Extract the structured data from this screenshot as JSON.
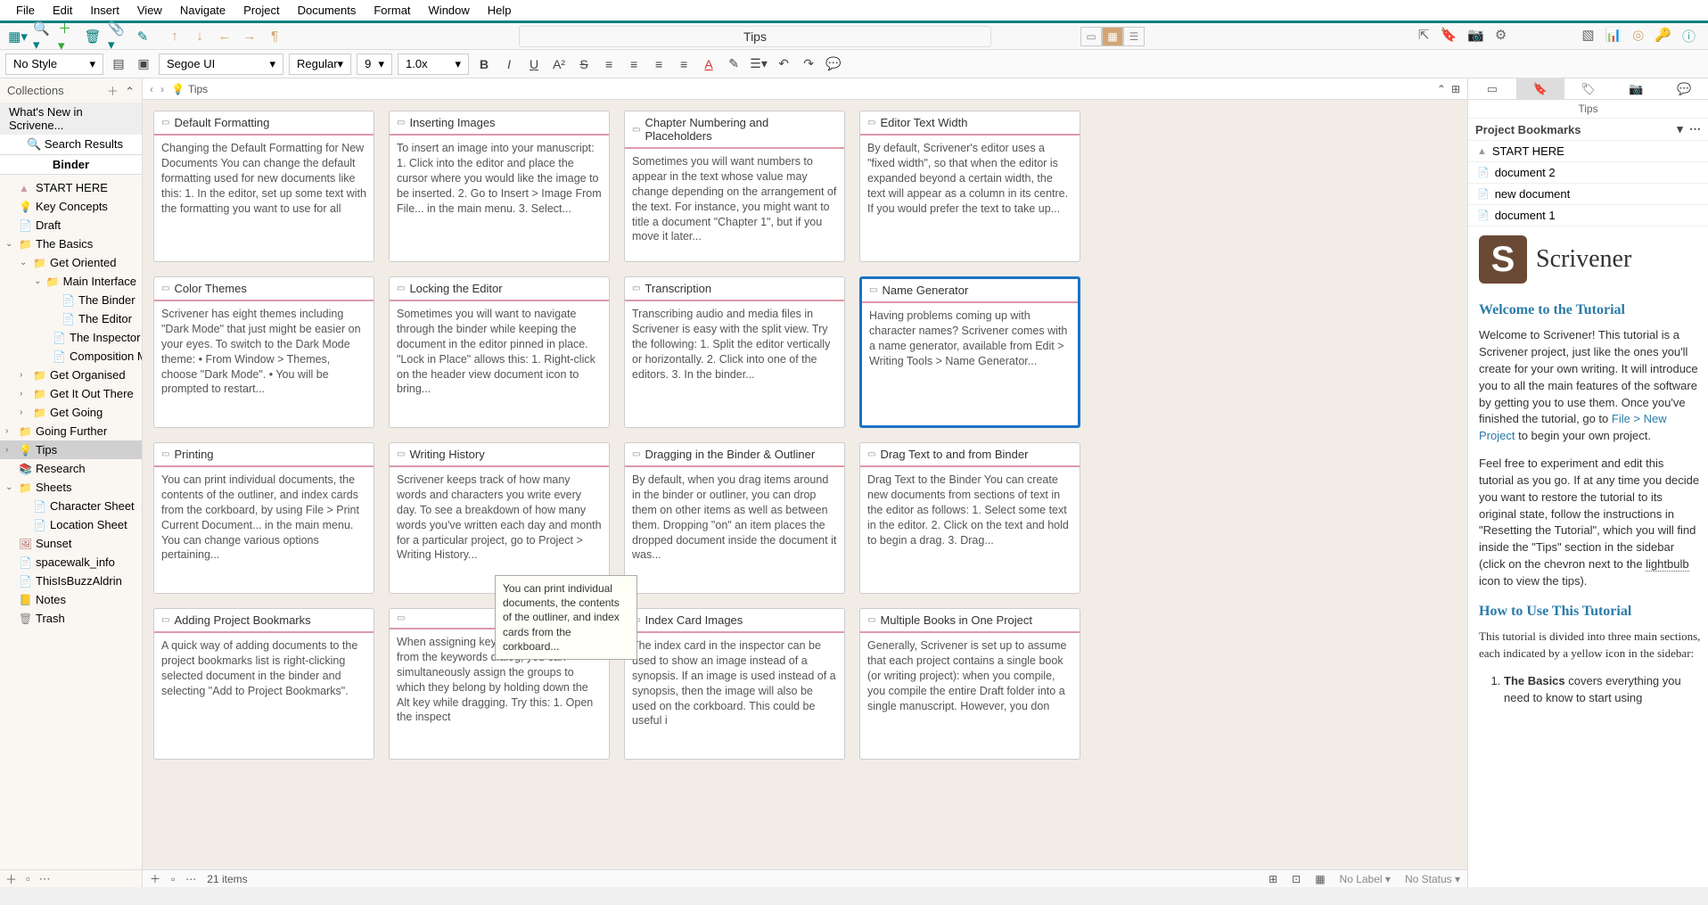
{
  "menu": [
    "File",
    "Edit",
    "Insert",
    "View",
    "Navigate",
    "Project",
    "Documents",
    "Format",
    "Window",
    "Help"
  ],
  "toolbar": {
    "centerTitle": "Tips"
  },
  "fmt": {
    "style": "No Style",
    "font": "Segoe UI",
    "weight": "Regular",
    "size": "9",
    "spacing": "1.0x"
  },
  "collections": {
    "header": "Collections",
    "whatsnew": "What's New in Scrivene...",
    "searchResults": "Search Results",
    "binder": "Binder"
  },
  "tree": [
    {
      "icon": "▲",
      "label": "START HERE",
      "indent": 0,
      "color": "#c9a",
      "tw": ""
    },
    {
      "icon": "💡",
      "label": "Key Concepts",
      "indent": 0,
      "color": "#c9a",
      "tw": ""
    },
    {
      "icon": "📄",
      "label": "Draft",
      "indent": 0,
      "color": "#888",
      "tw": ""
    },
    {
      "icon": "📁",
      "label": "The Basics",
      "indent": 0,
      "color": "#d9b04a",
      "tw": "⌄"
    },
    {
      "icon": "📁",
      "label": "Get Oriented",
      "indent": 1,
      "color": "#d9b04a",
      "tw": "⌄"
    },
    {
      "icon": "📁",
      "label": "Main Interface",
      "indent": 2,
      "color": "#d9b04a",
      "tw": "⌄"
    },
    {
      "icon": "📄",
      "label": "The Binder",
      "indent": 3,
      "color": "#888",
      "tw": ""
    },
    {
      "icon": "📄",
      "label": "The Editor",
      "indent": 3,
      "color": "#888",
      "tw": ""
    },
    {
      "icon": "📄",
      "label": "The Inspector",
      "indent": 3,
      "color": "#888",
      "tw": ""
    },
    {
      "icon": "📄",
      "label": "Composition Mode",
      "indent": 3,
      "color": "#888",
      "tw": ""
    },
    {
      "icon": "📁",
      "label": "Get Organised",
      "indent": 1,
      "color": "#d9b04a",
      "tw": "›"
    },
    {
      "icon": "📁",
      "label": "Get It Out There",
      "indent": 1,
      "color": "#d9b04a",
      "tw": "›"
    },
    {
      "icon": "📁",
      "label": "Get Going",
      "indent": 1,
      "color": "#d9b04a",
      "tw": "›"
    },
    {
      "icon": "📁",
      "label": "Going Further",
      "indent": 0,
      "color": "#d9b04a",
      "tw": "›"
    },
    {
      "icon": "💡",
      "label": "Tips",
      "indent": 0,
      "color": "#c9a",
      "tw": "›",
      "sel": true
    },
    {
      "icon": "📚",
      "label": "Research",
      "indent": 0,
      "color": "#888",
      "tw": ""
    },
    {
      "icon": "📁",
      "label": "Sheets",
      "indent": 0,
      "color": "#d9b04a",
      "tw": "⌄"
    },
    {
      "icon": "📄",
      "label": "Character Sheet",
      "indent": 1,
      "color": "#888",
      "tw": ""
    },
    {
      "icon": "📄",
      "label": "Location Sheet",
      "indent": 1,
      "color": "#888",
      "tw": ""
    },
    {
      "icon": "🖼",
      "label": "Sunset",
      "indent": 0,
      "color": "#a66",
      "tw": ""
    },
    {
      "icon": "📄",
      "label": "spacewalk_info",
      "indent": 0,
      "color": "#888",
      "tw": ""
    },
    {
      "icon": "📄",
      "label": "ThisIsBuzzAldrin",
      "indent": 0,
      "color": "#888",
      "tw": ""
    },
    {
      "icon": "📒",
      "label": "Notes",
      "indent": 0,
      "color": "#888",
      "tw": ""
    },
    {
      "icon": "🗑",
      "label": "Trash",
      "indent": 0,
      "color": "#888",
      "tw": ""
    }
  ],
  "breadcrumb": "Tips",
  "cards": [
    {
      "t": "Default Formatting",
      "b": "Changing the Default Formatting for New Documents You can change the default formatting used for new documents like this: 1. In the editor, set up some text with the formatting you want to use for all"
    },
    {
      "t": "Inserting Images",
      "b": "To insert an image into your manuscript: 1. Click into the editor and place the cursor where you would like the image to be inserted. 2. Go to Insert > Image From File... in the main menu. 3. Select..."
    },
    {
      "t": "Chapter Numbering and Placeholders",
      "b": "Sometimes you will want numbers to appear in the text whose value may change depending on the arrangement of the text. For instance, you might want to title a document \"Chapter 1\", but if you move it later..."
    },
    {
      "t": "Editor Text Width",
      "b": "By default, Scrivener's editor uses a \"fixed width\", so that when the editor is expanded beyond a certain width, the text will appear as a column in its centre. If you would prefer the text to take up..."
    },
    {
      "t": "Color Themes",
      "b": "Scrivener has eight themes including \"Dark Mode\" that just might be easier on your eyes. To switch to the Dark Mode theme: • From Window > Themes, choose \"Dark Mode\". • You will be prompted to restart..."
    },
    {
      "t": "Locking the Editor",
      "b": "Sometimes you will want to navigate through the binder while keeping the document in the editor pinned in place. \"Lock in Place\" allows this: 1. Right-click on the header view document icon to bring..."
    },
    {
      "t": "Transcription",
      "b": "Transcribing audio and media files in Scrivener is easy with the split view. Try the following: 1. Split the editor vertically or horizontally. 2. Click into one of the editors. 3. In the binder..."
    },
    {
      "t": "Name Generator",
      "b": "Having problems coming up with character names? Scrivener comes with a name generator, available from Edit > Writing Tools > Name Generator...",
      "sel": true
    },
    {
      "t": "Printing",
      "b": "You can print individual documents, the contents of the outliner, and index cards from the corkboard, by using File > Print Current Document... in the main menu. You can change various options pertaining..."
    },
    {
      "t": "Writing History",
      "b": "Scrivener keeps track of how many words and characters you write every day. To see a breakdown of how many words you've written each day and month for a particular project, go to Project > Writing History..."
    },
    {
      "t": "Dragging in the Binder & Outliner",
      "b": "By default, when you drag items around in the binder or outliner, you can drop them on other items as well as between them. Dropping \"on\" an item places the dropped document inside the document it was..."
    },
    {
      "t": "Drag Text to and from Binder",
      "b": "Drag Text to the Binder You can create new documents from sections of text in the editor as follows: 1. Select some text in the editor. 2. Click on the text and hold to begin a drag. 3. Drag..."
    },
    {
      "t": "Adding Project Bookmarks",
      "b": "A quick way of adding documents to the project bookmarks list is right-clicking selected document in the binder and selecting \"Add to Project Bookmarks\"."
    },
    {
      "t": "",
      "b": "When assigning keywords to documents from the keywords dialog, you can simultaneously assign the groups to which they belong by holding down the Alt key while dragging. Try this: 1. Open the inspect"
    },
    {
      "t": "Index Card Images",
      "b": "The index card in the inspector can be used to show an image instead of a synopsis. If an image is used instead of a synopsis, then the image will also be used on the corkboard. This could be useful i"
    },
    {
      "t": "Multiple Books in One Project",
      "b": "Generally, Scrivener is set up to assume that each project contains a single book (or writing project): when you compile, you compile the entire Draft folder into a single manuscript. However, you don"
    }
  ],
  "tooltip": "You can print individual documents, the contents of the outliner, and index cards from the corkboard...",
  "footer": {
    "items": "21 items",
    "label": "No Label",
    "status": "No Status"
  },
  "inspector": {
    "title": "Tips",
    "header": "Project Bookmarks",
    "bookmarks": [
      {
        "icon": "▲",
        "label": "START HERE"
      },
      {
        "icon": "📄",
        "label": "document 2"
      },
      {
        "icon": "📄",
        "label": "new document"
      },
      {
        "icon": "📄",
        "label": "document 1"
      }
    ],
    "logoText": "Scrivener",
    "h1": "Welcome to the Tutorial",
    "p1a": "Welcome to Scrivener! This tutorial is a Scrivener project, just like the ones you'll create for your own writing. It will introduce you to all the main features of the software by getting you to use them. Once you've finished the tutorial, go to ",
    "p1link": "File > New Project",
    "p1b": " to begin your own project.",
    "p2a": "Feel free to experiment and edit this tutorial as you go. If at any time you decide you want to restore the tutorial to its original state, follow the instructions in \"Resetting the Tutorial\", which you will find inside the \"Tips\" section in the sidebar (click on the chevron next to the ",
    "p2u": "lightbulb",
    "p2b": " icon to view the tips).",
    "h2": "How to Use This Tutorial",
    "p3": "This tutorial is divided into three main sections, each indicated by a yellow icon in the sidebar:",
    "li1a": "The Basics",
    "li1b": " covers everything you need to know to start using"
  }
}
